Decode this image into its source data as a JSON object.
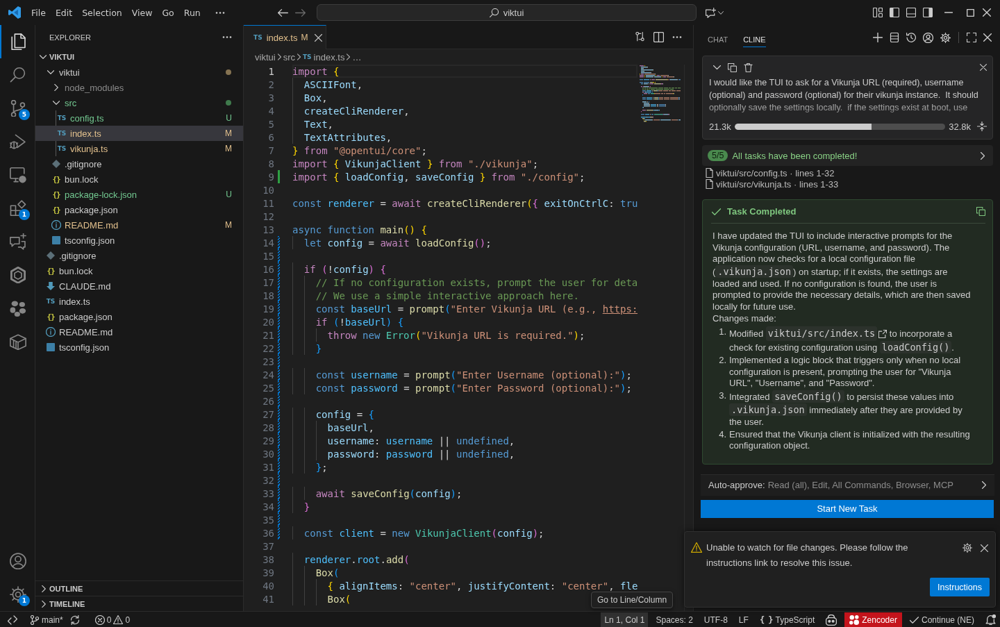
{
  "title_bar": {
    "menu": [
      {
        "label": "File"
      },
      {
        "label": "Edit"
      },
      {
        "label": "Selection"
      },
      {
        "label": "View"
      },
      {
        "label": "Go"
      },
      {
        "label": "Run"
      }
    ],
    "search": {
      "label": "viktui"
    }
  },
  "activity_bar": {
    "items": [
      {
        "kind": "files",
        "selected": true
      },
      {
        "kind": "search",
        "selected": false
      },
      {
        "kind": "source_control",
        "selected": false,
        "badge": "5"
      },
      {
        "kind": "run_debug",
        "selected": false
      },
      {
        "kind": "remote",
        "selected": false
      },
      {
        "kind": "extensions",
        "selected": false,
        "badge": "1"
      },
      {
        "kind": "chat",
        "selected": false
      },
      {
        "kind": "ring",
        "selected": false
      },
      {
        "kind": "flower",
        "selected": false
      },
      {
        "kind": "package",
        "selected": false
      }
    ],
    "bottom": [
      {
        "kind": "account"
      },
      {
        "kind": "settings",
        "badge": "1"
      }
    ]
  },
  "explorer": {
    "title": "EXPLORER",
    "root": {
      "label": "VIKTUI",
      "expanded": true
    },
    "tree": [
      {
        "name": "viktui",
        "kind": "folder",
        "expanded": true,
        "selected": false,
        "modified": false,
        "untracked": false,
        "ignored": false,
        "color": "#857352",
        "children": [
          {
            "name": "node_modules",
            "kind": "folder",
            "expanded": false,
            "selected": false,
            "modified": false,
            "untracked": false,
            "ignored": true
          },
          {
            "name": "src",
            "kind": "folder",
            "expanded": true,
            "selected": false,
            "modified": false,
            "untracked": true,
            "ignored": false,
            "color": "#3f7a4c",
            "children": [
              {
                "name": "config.ts",
                "kind": "ts",
                "icon_text": "TS",
                "selected": false,
                "modified": false,
                "untracked": true,
                "ignored": false,
                "badge": "U"
              },
              {
                "name": "index.ts",
                "kind": "ts",
                "icon_text": "TS",
                "selected": true,
                "modified": true,
                "untracked": false,
                "ignored": false,
                "badge": "M"
              },
              {
                "name": "vikunja.ts",
                "kind": "ts",
                "icon_text": "TS",
                "selected": false,
                "modified": true,
                "untracked": false,
                "ignored": false,
                "badge": "M"
              }
            ]
          },
          {
            "name": ".gitignore",
            "kind": "git",
            "selected": false,
            "modified": false,
            "untracked": false,
            "ignored": false
          },
          {
            "name": "bun.lock",
            "kind": "json",
            "icon_text": "{}",
            "selected": false,
            "modified": false,
            "untracked": false,
            "ignored": false
          },
          {
            "name": "package-lock.json",
            "kind": "json",
            "icon_text": "{}",
            "selected": false,
            "modified": false,
            "untracked": true,
            "ignored": false,
            "badge": "U"
          },
          {
            "name": "package.json",
            "kind": "json",
            "icon_text": "{}",
            "selected": false,
            "modified": false,
            "untracked": false,
            "ignored": false
          },
          {
            "name": "README.md",
            "kind": "info",
            "selected": false,
            "modified": true,
            "untracked": false,
            "ignored": false,
            "badge": "M"
          },
          {
            "name": "tsconfig.json",
            "kind": "tsconfig",
            "selected": false,
            "modified": false,
            "untracked": false,
            "ignored": false
          }
        ]
      },
      {
        "name": ".gitignore",
        "kind": "git",
        "selected": false,
        "modified": false,
        "untracked": false,
        "ignored": false
      },
      {
        "name": "bun.lock",
        "kind": "json",
        "icon_text": "{}",
        "selected": false,
        "modified": false,
        "untracked": false,
        "ignored": false
      },
      {
        "name": "CLAUDE.md",
        "kind": "markdown",
        "selected": false,
        "modified": false,
        "untracked": false,
        "ignored": false
      },
      {
        "name": "index.ts",
        "kind": "ts",
        "icon_text": "TS",
        "selected": false,
        "modified": false,
        "untracked": false,
        "ignored": false
      },
      {
        "name": "package.json",
        "kind": "json",
        "icon_text": "{}",
        "selected": false,
        "modified": false,
        "untracked": false,
        "ignored": false
      },
      {
        "name": "README.md",
        "kind": "info",
        "selected": false,
        "modified": false,
        "untracked": false,
        "ignored": false
      },
      {
        "name": "tsconfig.json",
        "kind": "tsconfig",
        "selected": false,
        "modified": false,
        "untracked": false,
        "ignored": false
      }
    ],
    "sections": [
      {
        "label": "OUTLINE",
        "expanded": false
      },
      {
        "label": "TIMELINE",
        "expanded": false
      }
    ]
  },
  "editor": {
    "tabs": [
      {
        "icon_text": "TS",
        "label": "index.ts",
        "badge": "M",
        "selected": true
      }
    ],
    "breadcrumbs": [
      {
        "label": "viktui"
      },
      {
        "label": "src"
      },
      {
        "icon_text": "TS",
        "label": "index.ts"
      },
      {
        "label": "…"
      }
    ],
    "lines": [
      {
        "number": "1",
        "current": true,
        "added": false,
        "modified": false,
        "tokens": [
          {
            "kind": "keyword",
            "text": "import"
          },
          {
            "kind": "bracket1",
            "text": " {"
          }
        ]
      },
      {
        "number": "2",
        "current": false,
        "added": false,
        "modified": false,
        "tokens": [
          {
            "kind": "variable",
            "text": "  ASCIIFont"
          },
          {
            "kind": "plain",
            "text": ","
          }
        ]
      },
      {
        "number": "3",
        "current": false,
        "added": false,
        "modified": false,
        "tokens": [
          {
            "kind": "variable",
            "text": "  Box"
          },
          {
            "kind": "plain",
            "text": ","
          }
        ]
      },
      {
        "number": "4",
        "current": false,
        "added": false,
        "modified": false,
        "tokens": [
          {
            "kind": "variable",
            "text": "  createCliRenderer"
          },
          {
            "kind": "plain",
            "text": ","
          }
        ]
      },
      {
        "number": "5",
        "current": false,
        "added": false,
        "modified": false,
        "tokens": [
          {
            "kind": "variable",
            "text": "  Text"
          },
          {
            "kind": "plain",
            "text": ","
          }
        ]
      },
      {
        "number": "6",
        "current": false,
        "added": false,
        "modified": false,
        "tokens": [
          {
            "kind": "variable",
            "text": "  TextAttributes"
          },
          {
            "kind": "plain",
            "text": ","
          }
        ]
      },
      {
        "number": "7",
        "current": false,
        "added": false,
        "modified": false,
        "tokens": [
          {
            "kind": "bracket1",
            "text": "}"
          },
          {
            "kind": "keyword",
            "text": " from"
          },
          {
            "kind": "string",
            "text": " \"@opentui/core\""
          },
          {
            "kind": "plain",
            "text": ";"
          }
        ]
      },
      {
        "number": "8",
        "current": false,
        "added": false,
        "modified": false,
        "tokens": [
          {
            "kind": "keyword",
            "text": "import"
          },
          {
            "kind": "bracket1",
            "text": " {"
          },
          {
            "kind": "variable",
            "text": " VikunjaClient"
          },
          {
            "kind": "bracket1",
            "text": " }"
          },
          {
            "kind": "keyword",
            "text": " from"
          },
          {
            "kind": "string",
            "text": " \"./vikunja\""
          },
          {
            "kind": "plain",
            "text": ";"
          }
        ]
      },
      {
        "number": "9",
        "current": false,
        "added": true,
        "modified": false,
        "tokens": [
          {
            "kind": "keyword",
            "text": "import"
          },
          {
            "kind": "bracket1",
            "text": " {"
          },
          {
            "kind": "variable",
            "text": " loadConfig"
          },
          {
            "kind": "plain",
            "text": ","
          },
          {
            "kind": "variable",
            "text": " saveConfig"
          },
          {
            "kind": "bracket1",
            "text": " }"
          },
          {
            "kind": "keyword",
            "text": " from"
          },
          {
            "kind": "string",
            "text": " \"./config\""
          },
          {
            "kind": "plain",
            "text": ";"
          }
        ]
      },
      {
        "number": "10",
        "current": false,
        "added": false,
        "modified": false
      },
      {
        "number": "11",
        "current": false,
        "added": false,
        "modified": false,
        "tokens": [
          {
            "kind": "storage",
            "text": "const"
          },
          {
            "kind": "constant",
            "text": " renderer"
          },
          {
            "kind": "plain",
            "text": " ="
          },
          {
            "kind": "keyword",
            "text": " await"
          },
          {
            "kind": "function",
            "text": " createCliRenderer"
          },
          {
            "kind": "bracket1",
            "text": "("
          },
          {
            "kind": "bracket2",
            "text": "{"
          },
          {
            "kind": "variable",
            "text": " exitOnCtrlC"
          },
          {
            "kind": "plain",
            "text": ":"
          },
          {
            "kind": "storage",
            "text": " tru"
          }
        ]
      },
      {
        "number": "12",
        "current": false,
        "added": false,
        "modified": false
      },
      {
        "number": "13",
        "current": false,
        "added": false,
        "modified": false,
        "tokens": [
          {
            "kind": "storage",
            "text": "async"
          },
          {
            "kind": "storage",
            "text": " function"
          },
          {
            "kind": "function",
            "text": " main"
          },
          {
            "kind": "bracket1",
            "text": "()"
          },
          {
            "kind": "bracket1",
            "text": " {"
          }
        ]
      },
      {
        "number": "14",
        "current": false,
        "added": false,
        "modified": true,
        "tokens": [
          {
            "kind": "storage",
            "text": "  let"
          },
          {
            "kind": "variable",
            "text": " config"
          },
          {
            "kind": "plain",
            "text": " ="
          },
          {
            "kind": "keyword",
            "text": " await"
          },
          {
            "kind": "function",
            "text": " loadConfig"
          },
          {
            "kind": "bracket2",
            "text": "()"
          },
          {
            "kind": "plain",
            "text": ";"
          }
        ]
      },
      {
        "number": "15",
        "current": false,
        "added": false,
        "modified": true
      },
      {
        "number": "16",
        "current": false,
        "added": false,
        "modified": true,
        "tokens": [
          {
            "kind": "keyword",
            "text": "  if"
          },
          {
            "kind": "bracket2",
            "text": " ("
          },
          {
            "kind": "plain",
            "text": "!"
          },
          {
            "kind": "variable",
            "text": "config"
          },
          {
            "kind": "bracket2",
            "text": ")"
          },
          {
            "kind": "bracket2",
            "text": " {"
          }
        ]
      },
      {
        "number": "17",
        "current": false,
        "added": false,
        "modified": true,
        "tokens": [
          {
            "kind": "comment",
            "text": "    // If no configuration exists, prompt the user for deta"
          }
        ]
      },
      {
        "number": "18",
        "current": false,
        "added": false,
        "modified": true,
        "tokens": [
          {
            "kind": "comment",
            "text": "    // We use a simple interactive approach here."
          }
        ]
      },
      {
        "number": "19",
        "current": false,
        "added": false,
        "modified": true,
        "tokens": [
          {
            "kind": "storage",
            "text": "    const"
          },
          {
            "kind": "constant",
            "text": " baseUrl"
          },
          {
            "kind": "plain",
            "text": " ="
          },
          {
            "kind": "function",
            "text": " prompt"
          },
          {
            "kind": "bracket3",
            "text": "("
          },
          {
            "kind": "string",
            "text": "\"Enter Vikunja URL (e.g., "
          },
          {
            "kind": "link",
            "text": "https:"
          }
        ]
      },
      {
        "number": "20",
        "current": false,
        "added": false,
        "modified": true,
        "tokens": [
          {
            "kind": "keyword",
            "text": "    if"
          },
          {
            "kind": "bracket3",
            "text": " ("
          },
          {
            "kind": "plain",
            "text": "!"
          },
          {
            "kind": "constant",
            "text": "baseUrl"
          },
          {
            "kind": "bracket3",
            "text": ")"
          },
          {
            "kind": "bracket3",
            "text": " {"
          }
        ]
      },
      {
        "number": "21",
        "current": false,
        "added": false,
        "modified": true,
        "tokens": [
          {
            "kind": "keyword",
            "text": "      throw"
          },
          {
            "kind": "storage",
            "text": " new"
          },
          {
            "kind": "class",
            "text": " Error"
          },
          {
            "kind": "bracket1",
            "text": "("
          },
          {
            "kind": "string",
            "text": "\"Vikunja URL is required.\""
          },
          {
            "kind": "bracket1",
            "text": ")"
          },
          {
            "kind": "plain",
            "text": ";"
          }
        ]
      },
      {
        "number": "22",
        "current": false,
        "added": false,
        "modified": true,
        "tokens": [
          {
            "kind": "bracket3",
            "text": "    }"
          }
        ]
      },
      {
        "number": "23",
        "current": false,
        "added": false,
        "modified": true
      },
      {
        "number": "24",
        "current": false,
        "added": false,
        "modified": true,
        "tokens": [
          {
            "kind": "storage",
            "text": "    const"
          },
          {
            "kind": "constant",
            "text": " username"
          },
          {
            "kind": "plain",
            "text": " ="
          },
          {
            "kind": "function",
            "text": " prompt"
          },
          {
            "kind": "bracket3",
            "text": "("
          },
          {
            "kind": "string",
            "text": "\"Enter Username (optional):\""
          },
          {
            "kind": "bracket3",
            "text": ")"
          },
          {
            "kind": "plain",
            "text": ";"
          }
        ]
      },
      {
        "number": "25",
        "current": false,
        "added": false,
        "modified": true,
        "tokens": [
          {
            "kind": "storage",
            "text": "    const"
          },
          {
            "kind": "constant",
            "text": " password"
          },
          {
            "kind": "plain",
            "text": " ="
          },
          {
            "kind": "function",
            "text": " prompt"
          },
          {
            "kind": "bracket3",
            "text": "("
          },
          {
            "kind": "string",
            "text": "\"Enter Password (optional):\""
          },
          {
            "kind": "bracket3",
            "text": ")"
          },
          {
            "kind": "plain",
            "text": ";"
          }
        ]
      },
      {
        "number": "26",
        "current": false,
        "added": false,
        "modified": true
      },
      {
        "number": "27",
        "current": false,
        "added": false,
        "modified": true,
        "tokens": [
          {
            "kind": "variable",
            "text": "    config"
          },
          {
            "kind": "plain",
            "text": " ="
          },
          {
            "kind": "bracket3",
            "text": " {"
          }
        ]
      },
      {
        "number": "28",
        "current": false,
        "added": false,
        "modified": true,
        "tokens": [
          {
            "kind": "variable",
            "text": "      baseUrl"
          },
          {
            "kind": "plain",
            "text": ","
          }
        ]
      },
      {
        "number": "29",
        "current": false,
        "added": false,
        "modified": true,
        "tokens": [
          {
            "kind": "variable",
            "text": "      username"
          },
          {
            "kind": "plain",
            "text": ":"
          },
          {
            "kind": "constant",
            "text": " username"
          },
          {
            "kind": "plain",
            "text": " ||"
          },
          {
            "kind": "storage",
            "text": " undefined"
          },
          {
            "kind": "plain",
            "text": ","
          }
        ]
      },
      {
        "number": "30",
        "current": false,
        "added": false,
        "modified": true,
        "tokens": [
          {
            "kind": "variable",
            "text": "      password"
          },
          {
            "kind": "plain",
            "text": ":"
          },
          {
            "kind": "constant",
            "text": " password"
          },
          {
            "kind": "plain",
            "text": " ||"
          },
          {
            "kind": "storage",
            "text": " undefined"
          },
          {
            "kind": "plain",
            "text": ","
          }
        ]
      },
      {
        "number": "31",
        "current": false,
        "added": false,
        "modified": true,
        "tokens": [
          {
            "kind": "bracket3",
            "text": "    }"
          },
          {
            "kind": "plain",
            "text": ";"
          }
        ]
      },
      {
        "number": "32",
        "current": false,
        "added": false,
        "modified": true
      },
      {
        "number": "33",
        "current": false,
        "added": false,
        "modified": true,
        "tokens": [
          {
            "kind": "keyword",
            "text": "    await"
          },
          {
            "kind": "function",
            "text": " saveConfig"
          },
          {
            "kind": "bracket3",
            "text": "("
          },
          {
            "kind": "variable",
            "text": "config"
          },
          {
            "kind": "bracket3",
            "text": ")"
          },
          {
            "kind": "plain",
            "text": ";"
          }
        ]
      },
      {
        "number": "34",
        "current": false,
        "added": false,
        "modified": true,
        "tokens": [
          {
            "kind": "bracket2",
            "text": "  }"
          }
        ]
      },
      {
        "number": "35",
        "current": false,
        "added": false,
        "modified": true
      },
      {
        "number": "36",
        "current": false,
        "added": false,
        "modified": true,
        "tokens": [
          {
            "kind": "storage",
            "text": "  const"
          },
          {
            "kind": "constant",
            "text": " client"
          },
          {
            "kind": "plain",
            "text": " ="
          },
          {
            "kind": "storage",
            "text": " new"
          },
          {
            "kind": "class",
            "text": " VikunjaClient"
          },
          {
            "kind": "bracket2",
            "text": "("
          },
          {
            "kind": "variable",
            "text": "config"
          },
          {
            "kind": "bracket2",
            "text": ")"
          },
          {
            "kind": "plain",
            "text": ";"
          }
        ]
      },
      {
        "number": "37",
        "current": false,
        "added": false,
        "modified": false
      },
      {
        "number": "38",
        "current": false,
        "added": false,
        "modified": false,
        "tokens": [
          {
            "kind": "constant",
            "text": "  renderer"
          },
          {
            "kind": "plain",
            "text": "."
          },
          {
            "kind": "constant",
            "text": "root"
          },
          {
            "kind": "plain",
            "text": "."
          },
          {
            "kind": "function",
            "text": "add"
          },
          {
            "kind": "bracket2",
            "text": "("
          }
        ]
      },
      {
        "number": "39",
        "current": false,
        "added": false,
        "modified": false,
        "tokens": [
          {
            "kind": "function",
            "text": "    Box"
          },
          {
            "kind": "bracket3",
            "text": "("
          }
        ]
      },
      {
        "number": "40",
        "current": false,
        "added": false,
        "modified": false,
        "tokens": [
          {
            "kind": "bracket1",
            "text": "      {"
          },
          {
            "kind": "variable",
            "text": " alignItems"
          },
          {
            "kind": "plain",
            "text": ":"
          },
          {
            "kind": "string",
            "text": " \"center\""
          },
          {
            "kind": "plain",
            "text": ","
          },
          {
            "kind": "variable",
            "text": " justifyContent"
          },
          {
            "kind": "plain",
            "text": ":"
          },
          {
            "kind": "string",
            "text": " \"center\""
          },
          {
            "kind": "plain",
            "text": ","
          },
          {
            "kind": "variable",
            "text": " fle"
          }
        ]
      },
      {
        "number": "41",
        "current": false,
        "added": false,
        "modified": false,
        "tokens": [
          {
            "kind": "function",
            "text": "      Box"
          },
          {
            "kind": "bracket1",
            "text": "("
          }
        ]
      }
    ]
  },
  "side_panel": {
    "tabs": [
      {
        "label": "CHAT",
        "selected": false
      },
      {
        "label": "CLINE",
        "selected": true
      }
    ],
    "task": {
      "text": "I would like the TUI to ask for a Vikunja URL (required), username (optional) and password (optional) for their vikunja instance.  It should optionally save the settings locally.  if the settings exist at boot, use",
      "context": {
        "used": "21.3k",
        "level": 0.65,
        "total": "32.8k"
      }
    },
    "progress": {
      "count": "5/5",
      "label": "All tasks have been completed!"
    },
    "files": [
      "viktui/src/config.ts · lines 1-32",
      "viktui/src/vikunja.ts · lines 1-33"
    ],
    "completion": {
      "title": "Task Completed",
      "summary": [
        {
          "kind": "text",
          "text": "I have updated the TUI to include interactive prompts for the Vikunja configuration (URL, username, and password). The application now checks for a local configuration file ("
        },
        {
          "kind": "code",
          "text": ".vikunja.json"
        },
        {
          "kind": "text",
          "text": ") on startup; if it exists, the settings are loaded and used. If no configuration is found, the user is prompted to provide the necessary details, which are then saved locally for future use."
        }
      ],
      "changes_heading": "Changes made:",
      "changes": [
        {
          "number": "1.",
          "segments": [
            {
              "kind": "text",
              "text": "Modified "
            },
            {
              "kind": "file_link",
              "text": "viktui/src/index.ts"
            },
            {
              "kind": "text",
              "text": " to incorporate a check for existing configuration using "
            },
            {
              "kind": "code",
              "text": "loadConfig()"
            },
            {
              "kind": "text",
              "text": "."
            }
          ]
        },
        {
          "number": "2.",
          "segments": [
            {
              "kind": "text",
              "text": "Implemented a logic block that triggers only when no local configuration is present, prompting the user for \"Vikunja URL\", \"Username\", and \"Password\"."
            }
          ]
        },
        {
          "number": "3.",
          "segments": [
            {
              "kind": "text",
              "text": "Integrated "
            },
            {
              "kind": "code",
              "text": "saveConfig()"
            },
            {
              "kind": "text",
              "text": " to persist these values into "
            },
            {
              "kind": "code",
              "text": ".vikunja.json"
            },
            {
              "kind": "text",
              "text": " immediately after they are provided by the user."
            }
          ]
        },
        {
          "number": "4.",
          "segments": [
            {
              "kind": "text",
              "text": "Ensured that the Vikunja client is initialized with the resulting configuration object."
            }
          ]
        }
      ]
    },
    "auto_approve": {
      "label": "Auto-approve:",
      "value": "Read (all), Edit, All Commands, Browser, MCP"
    },
    "start_button": "Start New Task"
  },
  "notification": {
    "message": "Unable to watch for file changes. Please follow the instructions link to resolve this issue.",
    "button": "Instructions"
  },
  "tooltip": {
    "text": "Go to Line/Column"
  },
  "status_bar": {
    "left": [
      {
        "kind": "remote"
      },
      {
        "kind": "branch",
        "text": "main*"
      },
      {
        "kind": "sync"
      },
      {
        "kind": "problems",
        "errors": "0",
        "warnings": "0"
      }
    ],
    "right": [
      {
        "kind": "text",
        "text": "Ln 1, Col 1",
        "hovered": true,
        "alert": false
      },
      {
        "kind": "text",
        "text": "Spaces: 2",
        "hovered": false,
        "alert": false
      },
      {
        "kind": "text",
        "text": "UTF-8",
        "hovered": false,
        "alert": false
      },
      {
        "kind": "text",
        "text": "LF",
        "hovered": false,
        "alert": false
      },
      {
        "kind": "language",
        "icon_text": "{ }",
        "text": "TypeScript",
        "hovered": false,
        "alert": false
      },
      {
        "kind": "copilot",
        "hovered": false,
        "alert": false
      },
      {
        "kind": "zencoder",
        "text": "Zencoder",
        "hovered": false,
        "alert": true
      },
      {
        "kind": "continue",
        "text": "Continue (NE)",
        "hovered": false,
        "alert": false
      },
      {
        "kind": "bell",
        "hovered": false,
        "alert": false
      }
    ]
  }
}
